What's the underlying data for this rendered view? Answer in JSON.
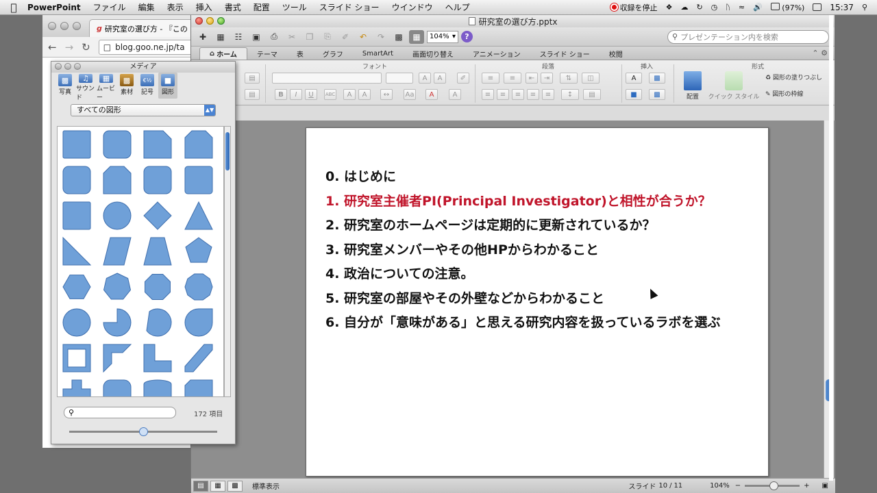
{
  "menubar": {
    "app": "PowerPoint",
    "items": [
      "ファイル",
      "編集",
      "表示",
      "挿入",
      "書式",
      "配置",
      "ツール",
      "スライド ショー",
      "ウインドウ",
      "ヘルプ"
    ],
    "record_label": "収録を停止",
    "battery": "(97%)",
    "clock": "15:37"
  },
  "browser": {
    "tab_title": "研究室の選び方 - 『この",
    "url": "blog.goo.ne.jp/ta"
  },
  "ppt": {
    "filename": "研究室の選び方.pptx",
    "zoom": "104%",
    "search_placeholder": "プレゼンテーション内を検索",
    "ribbon_tabs": [
      "ホーム",
      "テーマ",
      "表",
      "グラフ",
      "SmartArt",
      "画面切り替え",
      "アニメーション",
      "スライド ショー",
      "校閲"
    ],
    "groups": {
      "font": "フォント",
      "paragraph": "段落",
      "insert": "挿入",
      "format": "形式"
    },
    "ribbon_labels": {
      "arrange": "配置",
      "quick_style": "クイック スタイル",
      "shape_fill": "図形の塗りつぶし",
      "shape_outline": "図形の枠線"
    },
    "status": {
      "view": "標準表示",
      "slide_word": "スライド",
      "slide_current": "10",
      "slide_total": "11",
      "zoom": "104%"
    }
  },
  "slide": {
    "lines": [
      {
        "text": "0. はじめに",
        "highlight": false
      },
      {
        "text": "1. 研究室主催者PI(Principal Investigator)と相性が合うか？",
        "highlight": true
      },
      {
        "text": "2. 研究室のホームページは定期的に更新されているか？",
        "highlight": false
      },
      {
        "text": "3. 研究室メンバーやその他HPからわかること",
        "highlight": false
      },
      {
        "text": "4. 政治についての注意。",
        "highlight": false
      },
      {
        "text": "5. 研究室の部屋やその外壁などからわかること",
        "highlight": false
      },
      {
        "text": "6. 自分が「意味がある」と思える研究内容を扱っているラボを選ぶ",
        "highlight": false
      }
    ],
    "highlight_color": "#c0142a"
  },
  "media": {
    "title": "メディア",
    "tabs": [
      "写真",
      "サウンド",
      "ムービー",
      "素材",
      "記号",
      "図形"
    ],
    "category": "すべての図形",
    "count": "172 項目",
    "shape_color": "#6fa0d8"
  }
}
